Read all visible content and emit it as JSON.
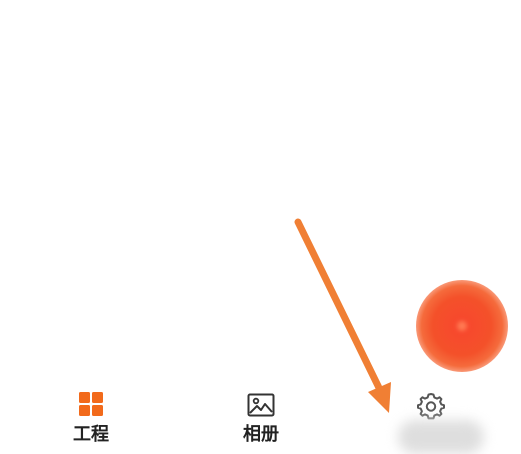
{
  "tabbar": {
    "tabs": [
      {
        "label": "工程",
        "icon": "grid-icon",
        "color": "#f26a1b"
      },
      {
        "label": "相册",
        "icon": "image-icon",
        "color": "#333333"
      },
      {
        "label": "",
        "icon": "gear-icon",
        "color": "#555555"
      }
    ]
  },
  "floating_button": {
    "icon": "record-icon",
    "color": "#f4512a"
  },
  "annotation": {
    "icon": "arrow-icon",
    "color": "#f07f34"
  }
}
